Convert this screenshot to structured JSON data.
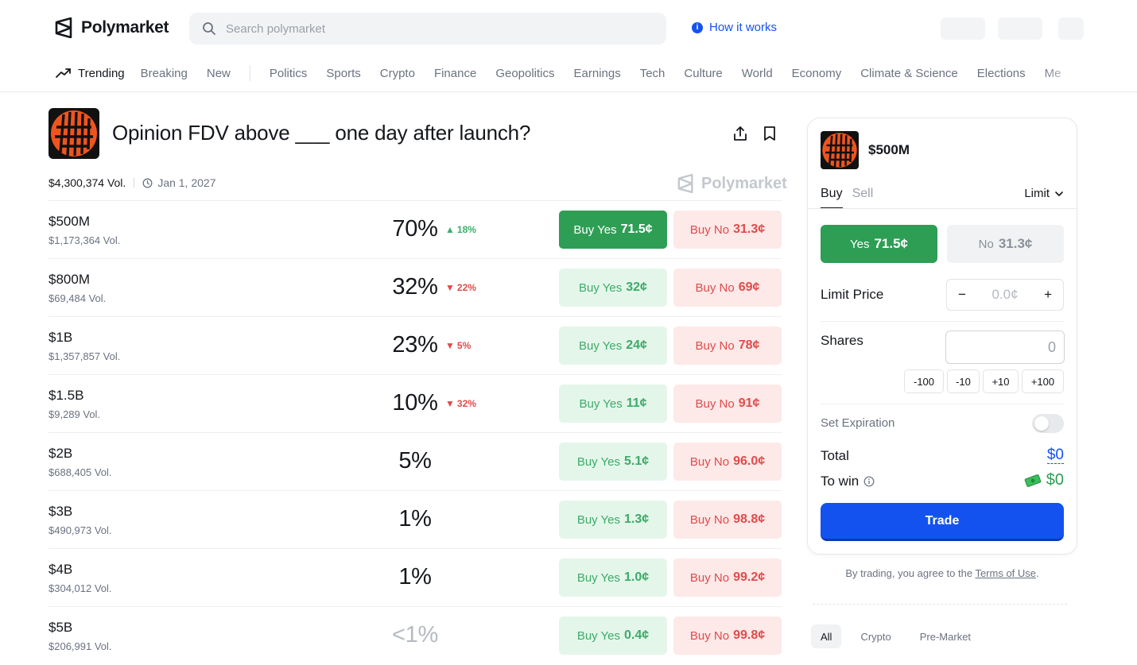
{
  "header": {
    "brand": "Polymarket",
    "search_placeholder": "Search polymarket",
    "how_it_works": "How it works"
  },
  "nav": {
    "trending": "Trending",
    "primary": [
      "Breaking",
      "New"
    ],
    "categories": [
      "Politics",
      "Sports",
      "Crypto",
      "Finance",
      "Geopolitics",
      "Earnings",
      "Tech",
      "Culture",
      "World",
      "Economy",
      "Climate & Science",
      "Elections",
      "Me"
    ]
  },
  "market": {
    "title": "Opinion FDV above ___ one day after launch?",
    "volume": "$4,300,374 Vol.",
    "end_date": "Jan 1, 2027",
    "watermark": "Polymarket",
    "outcomes": [
      {
        "label": "$500M",
        "volume": "$1,173,364 Vol.",
        "probability": "70%",
        "change": "18%",
        "direction": "up",
        "yes_text": "Buy Yes",
        "yes_price": "71.5¢",
        "no_text": "Buy No",
        "no_price": "31.3¢"
      },
      {
        "label": "$800M",
        "volume": "$69,484 Vol.",
        "probability": "32%",
        "change": "22%",
        "direction": "down",
        "yes_text": "Buy Yes",
        "yes_price": "32¢",
        "no_text": "Buy No",
        "no_price": "69¢"
      },
      {
        "label": "$1B",
        "volume": "$1,357,857 Vol.",
        "probability": "23%",
        "change": "5%",
        "direction": "down",
        "yes_text": "Buy Yes",
        "yes_price": "24¢",
        "no_text": "Buy No",
        "no_price": "78¢"
      },
      {
        "label": "$1.5B",
        "volume": "$9,289 Vol.",
        "probability": "10%",
        "change": "32%",
        "direction": "down",
        "yes_text": "Buy Yes",
        "yes_price": "11¢",
        "no_text": "Buy No",
        "no_price": "91¢"
      },
      {
        "label": "$2B",
        "volume": "$688,405 Vol.",
        "probability": "5%",
        "change": "",
        "direction": "",
        "yes_text": "Buy Yes",
        "yes_price": "5.1¢",
        "no_text": "Buy No",
        "no_price": "96.0¢"
      },
      {
        "label": "$3B",
        "volume": "$490,973 Vol.",
        "probability": "1%",
        "change": "",
        "direction": "",
        "yes_text": "Buy Yes",
        "yes_price": "1.3¢",
        "no_text": "Buy No",
        "no_price": "98.8¢"
      },
      {
        "label": "$4B",
        "volume": "$304,012 Vol.",
        "probability": "1%",
        "change": "",
        "direction": "",
        "yes_text": "Buy Yes",
        "yes_price": "1.0¢",
        "no_text": "Buy No",
        "no_price": "99.2¢"
      },
      {
        "label": "$5B",
        "volume": "$206,991 Vol.",
        "probability": "<1%",
        "change": "",
        "direction": "",
        "yes_text": "Buy Yes",
        "yes_price": "0.4¢",
        "no_text": "Buy No",
        "no_price": "99.8¢"
      }
    ]
  },
  "trade_panel": {
    "title": "$500M",
    "tab_buy": "Buy",
    "tab_sell": "Sell",
    "order_type": "Limit",
    "yes_label": "Yes",
    "yes_price": "71.5¢",
    "no_label": "No",
    "no_price": "31.3¢",
    "limit_price_label": "Limit Price",
    "limit_minus": "−",
    "limit_value": "0.0¢",
    "limit_plus": "+",
    "shares_label": "Shares",
    "shares_value": "0",
    "quick_amounts": [
      "-100",
      "-10",
      "+10",
      "+100"
    ],
    "set_expiration_label": "Set Expiration",
    "total_label": "Total",
    "total_value": "$0",
    "to_win_label": "To win",
    "to_win_value": "$0",
    "trade_button": "Trade"
  },
  "terms": {
    "prefix": "By trading, you agree to the",
    "link": "Terms of Use",
    "suffix": "."
  },
  "filter_chips": [
    "All",
    "Crypto",
    "Pre-Market"
  ],
  "colors": {
    "accent_blue": "#1452f0",
    "yes_green": "#2e9e55",
    "no_red": "#e04b4b",
    "market_icon_orange": "#f0541e"
  }
}
